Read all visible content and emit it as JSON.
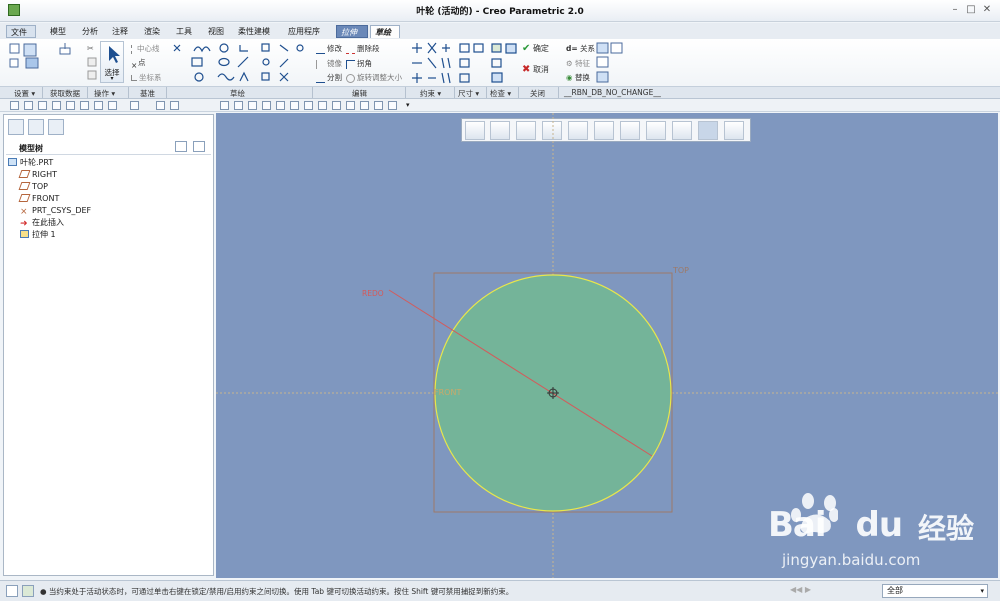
{
  "window": {
    "title": "叶轮 (活动的) - Creo Parametric 2.0"
  },
  "tabs": [
    {
      "label": "文件 ▾",
      "type": "file"
    },
    {
      "label": "模型",
      "type": "normal"
    },
    {
      "label": "分析",
      "type": "normal"
    },
    {
      "label": "注释",
      "type": "normal"
    },
    {
      "label": "渲染",
      "type": "normal"
    },
    {
      "label": "工具",
      "type": "normal"
    },
    {
      "label": "视图",
      "type": "normal"
    },
    {
      "label": "柔性建模",
      "type": "normal"
    },
    {
      "label": "应用程序",
      "type": "normal"
    },
    {
      "label": "拉伸",
      "type": "ctx"
    },
    {
      "label": "草绘",
      "type": "active"
    }
  ],
  "ribbon": {
    "select_label": "选择",
    "centerline_label": "中心线",
    "point_label": "点",
    "csys_label": "坐标系",
    "modify_label": "修改",
    "delete_segment_label": "删除段",
    "mirror_label": "镜像",
    "corner_label": "拐角",
    "divide_label": "分割",
    "rotate_resize_label": "旋转调整大小",
    "ok_label": "确定",
    "cancel_label": "取消",
    "relations_label": "关系",
    "features_label": "特征",
    "replace_label": "替换"
  },
  "groups": [
    {
      "label": "设置 ▾"
    },
    {
      "label": "获取数据"
    },
    {
      "label": "操作 ▾"
    },
    {
      "label": "基准"
    },
    {
      "label": "草绘"
    },
    {
      "label": "编辑"
    },
    {
      "label": "约束 ▾"
    },
    {
      "label": "尺寸 ▾"
    },
    {
      "label": "检查 ▾"
    },
    {
      "label": "关闭"
    },
    {
      "label": "__RBN_DB_NO_CHANGE__"
    }
  ],
  "model_tree": {
    "header": "模型树",
    "items": [
      {
        "label": "叶轮.PRT",
        "icon": "part-icon"
      },
      {
        "label": "RIGHT",
        "icon": "datum-plane-icon"
      },
      {
        "label": "TOP",
        "icon": "datum-plane-icon"
      },
      {
        "label": "FRONT",
        "icon": "datum-plane-icon"
      },
      {
        "label": "PRT_CSYS_DEF",
        "icon": "csys-icon"
      },
      {
        "label": "在此插入",
        "icon": "insert-here-icon"
      },
      {
        "label": "拉伸 1",
        "icon": "extrude-icon"
      }
    ]
  },
  "sketch": {
    "top_label": "TOP",
    "front_label": "FRONT",
    "radius_label": "REDO",
    "fill_color": "#74b499",
    "outline_color": "#e9e74a"
  },
  "status": {
    "message": "● 当约束处于活动状态时，可通过单击右键在锁定/禁用/启用约束之间切换。使用 Tab 键可切换活动约束。按住 Shift 键可禁用捕捉到新约束。",
    "filter": "全部"
  },
  "watermark": {
    "brand": "Bai",
    "brand2": "du",
    "cn": "经验",
    "url": "jingyan.baidu.com"
  }
}
